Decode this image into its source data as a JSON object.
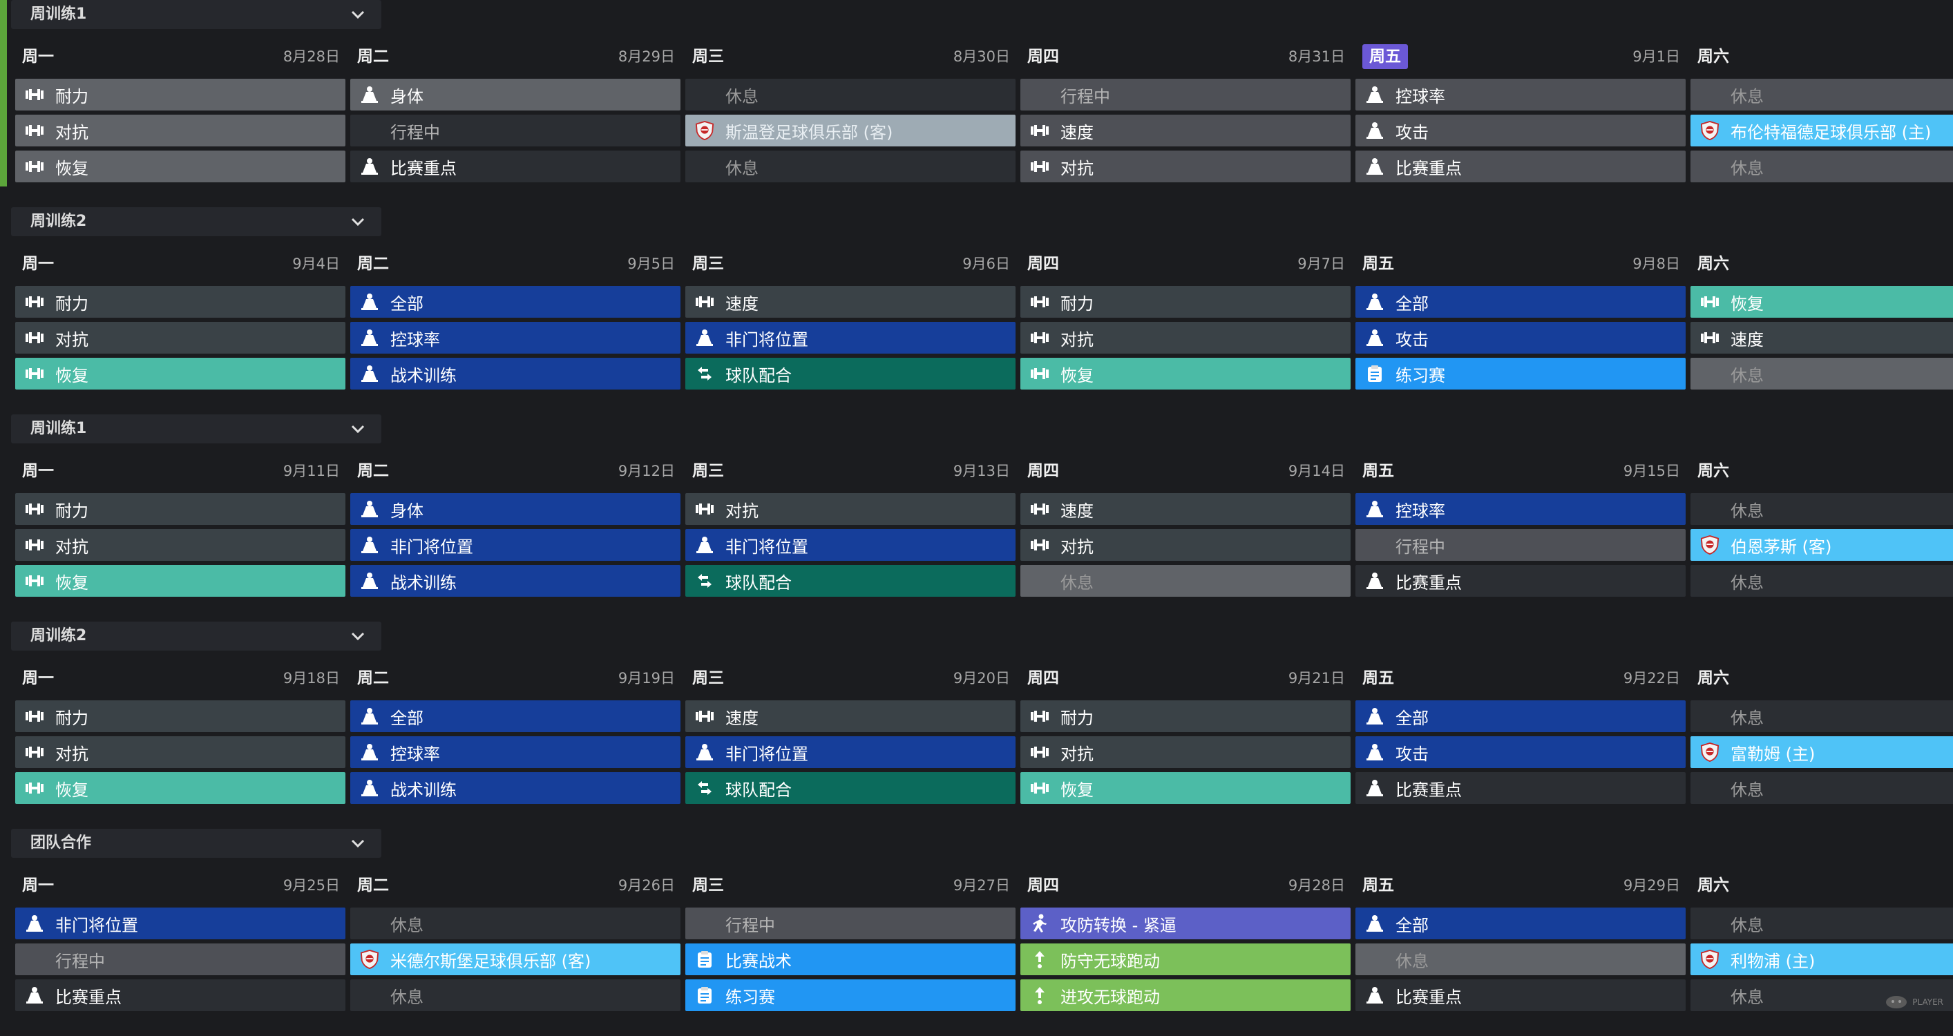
{
  "colors": {
    "grey": "#4e5056",
    "light_grey": "#606368",
    "dark": "#2b2e33",
    "slate": "#3a4247",
    "blue": "#163e9a",
    "teal": "#4bbba6",
    "dark_teal": "#0b6b5c",
    "sky": "#2196f3",
    "cyan": "#4fc3f7",
    "purple": "#5c60c7",
    "green": "#7cc05a",
    "today": "#6b58d6",
    "accent": "#5ca63b"
  },
  "watermark": "PLAYER",
  "weeks": [
    {
      "title": "周训练1",
      "days": [
        {
          "name": "周一",
          "date": "8月28日",
          "cells": [
            {
              "label": "耐力",
              "icon": "dumbbell-icon",
              "tone": "t-lgrey"
            },
            {
              "label": "对抗",
              "icon": "dumbbell-icon",
              "tone": "t-lgrey"
            },
            {
              "label": "恢复",
              "icon": "dumbbell-icon",
              "tone": "t-lgrey"
            }
          ]
        },
        {
          "name": "周二",
          "date": "8月29日",
          "cells": [
            {
              "label": "身体",
              "icon": "cone-icon",
              "tone": "t-lgrey"
            },
            {
              "label": "行程中",
              "icon": "none",
              "tone": "t-dark",
              "kind": "travel"
            },
            {
              "label": "比赛重点",
              "icon": "cone-icon",
              "tone": "t-dark"
            }
          ]
        },
        {
          "name": "周三",
          "date": "8月30日",
          "cells": [
            {
              "label": "休息",
              "icon": "none",
              "tone": "t-dark",
              "kind": "rest"
            },
            {
              "label": "斯温登足球俱乐部 (客)",
              "icon": "club-crest-icon",
              "tone": "t-match-grey"
            },
            {
              "label": "休息",
              "icon": "none",
              "tone": "t-dark",
              "kind": "rest"
            }
          ]
        },
        {
          "name": "周四",
          "date": "8月31日",
          "cells": [
            {
              "label": "行程中",
              "icon": "none",
              "tone": "t-grey",
              "kind": "travel"
            },
            {
              "label": "速度",
              "icon": "dumbbell-icon",
              "tone": "t-grey"
            },
            {
              "label": "对抗",
              "icon": "dumbbell-icon",
              "tone": "t-grey"
            }
          ]
        },
        {
          "name": "周五",
          "date": "9月1日",
          "today": true,
          "cells": [
            {
              "label": "控球率",
              "icon": "cone-icon",
              "tone": "t-grey"
            },
            {
              "label": "攻击",
              "icon": "cone-icon",
              "tone": "t-grey"
            },
            {
              "label": "比赛重点",
              "icon": "cone-icon",
              "tone": "t-grey"
            }
          ]
        },
        {
          "name": "周六",
          "date": "",
          "cells": [
            {
              "label": "休息",
              "icon": "none",
              "tone": "t-grey",
              "kind": "rest"
            },
            {
              "label": "布伦特福德足球俱乐部 (主)",
              "icon": "club-crest-icon",
              "tone": "t-cyan"
            },
            {
              "label": "休息",
              "icon": "none",
              "tone": "t-grey",
              "kind": "rest"
            }
          ]
        }
      ]
    },
    {
      "title": "周训练2",
      "days": [
        {
          "name": "周一",
          "date": "9月4日",
          "cells": [
            {
              "label": "耐力",
              "icon": "dumbbell-icon",
              "tone": "t-slate"
            },
            {
              "label": "对抗",
              "icon": "dumbbell-icon",
              "tone": "t-slate"
            },
            {
              "label": "恢复",
              "icon": "dumbbell-icon",
              "tone": "t-teal"
            }
          ]
        },
        {
          "name": "周二",
          "date": "9月5日",
          "cells": [
            {
              "label": "全部",
              "icon": "cone-icon",
              "tone": "t-blue"
            },
            {
              "label": "控球率",
              "icon": "cone-icon",
              "tone": "t-blue"
            },
            {
              "label": "战术训练",
              "icon": "cone-icon",
              "tone": "t-blue"
            }
          ]
        },
        {
          "name": "周三",
          "date": "9月6日",
          "cells": [
            {
              "label": "速度",
              "icon": "dumbbell-icon",
              "tone": "t-slate"
            },
            {
              "label": "非门将位置",
              "icon": "cone-icon",
              "tone": "t-blue"
            },
            {
              "label": "球队配合",
              "icon": "swap-icon",
              "tone": "t-dteal"
            }
          ]
        },
        {
          "name": "周四",
          "date": "9月7日",
          "cells": [
            {
              "label": "耐力",
              "icon": "dumbbell-icon",
              "tone": "t-slate"
            },
            {
              "label": "对抗",
              "icon": "dumbbell-icon",
              "tone": "t-slate"
            },
            {
              "label": "恢复",
              "icon": "dumbbell-icon",
              "tone": "t-teal"
            }
          ]
        },
        {
          "name": "周五",
          "date": "9月8日",
          "cells": [
            {
              "label": "全部",
              "icon": "cone-icon",
              "tone": "t-blue"
            },
            {
              "label": "攻击",
              "icon": "cone-icon",
              "tone": "t-blue"
            },
            {
              "label": "练习赛",
              "icon": "clipboard-icon",
              "tone": "t-sky"
            }
          ]
        },
        {
          "name": "周六",
          "date": "",
          "cells": [
            {
              "label": "恢复",
              "icon": "dumbbell-icon",
              "tone": "t-teal"
            },
            {
              "label": "速度",
              "icon": "dumbbell-icon",
              "tone": "t-slate"
            },
            {
              "label": "休息",
              "icon": "none",
              "tone": "t-lgrey",
              "kind": "rest"
            }
          ]
        }
      ]
    },
    {
      "title": "周训练1",
      "days": [
        {
          "name": "周一",
          "date": "9月11日",
          "cells": [
            {
              "label": "耐力",
              "icon": "dumbbell-icon",
              "tone": "t-slate"
            },
            {
              "label": "对抗",
              "icon": "dumbbell-icon",
              "tone": "t-slate"
            },
            {
              "label": "恢复",
              "icon": "dumbbell-icon",
              "tone": "t-teal"
            }
          ]
        },
        {
          "name": "周二",
          "date": "9月12日",
          "cells": [
            {
              "label": "身体",
              "icon": "cone-icon",
              "tone": "t-blue"
            },
            {
              "label": "非门将位置",
              "icon": "cone-icon",
              "tone": "t-blue"
            },
            {
              "label": "战术训练",
              "icon": "cone-icon",
              "tone": "t-blue"
            }
          ]
        },
        {
          "name": "周三",
          "date": "9月13日",
          "cells": [
            {
              "label": "对抗",
              "icon": "dumbbell-icon",
              "tone": "t-slate"
            },
            {
              "label": "非门将位置",
              "icon": "cone-icon",
              "tone": "t-blue"
            },
            {
              "label": "球队配合",
              "icon": "swap-icon",
              "tone": "t-dteal"
            }
          ]
        },
        {
          "name": "周四",
          "date": "9月14日",
          "cells": [
            {
              "label": "速度",
              "icon": "dumbbell-icon",
              "tone": "t-slate"
            },
            {
              "label": "对抗",
              "icon": "dumbbell-icon",
              "tone": "t-slate"
            },
            {
              "label": "休息",
              "icon": "none",
              "tone": "t-lgrey",
              "kind": "rest"
            }
          ]
        },
        {
          "name": "周五",
          "date": "9月15日",
          "cells": [
            {
              "label": "控球率",
              "icon": "cone-icon",
              "tone": "t-blue"
            },
            {
              "label": "行程中",
              "icon": "none",
              "tone": "t-grey",
              "kind": "travel"
            },
            {
              "label": "比赛重点",
              "icon": "cone-icon",
              "tone": "t-dark"
            }
          ]
        },
        {
          "name": "周六",
          "date": "",
          "cells": [
            {
              "label": "休息",
              "icon": "none",
              "tone": "t-dark",
              "kind": "rest"
            },
            {
              "label": "伯恩茅斯 (客)",
              "icon": "club-crest-icon",
              "tone": "t-cyan"
            },
            {
              "label": "休息",
              "icon": "none",
              "tone": "t-dark",
              "kind": "rest"
            }
          ]
        }
      ]
    },
    {
      "title": "周训练2",
      "days": [
        {
          "name": "周一",
          "date": "9月18日",
          "cells": [
            {
              "label": "耐力",
              "icon": "dumbbell-icon",
              "tone": "t-slate"
            },
            {
              "label": "对抗",
              "icon": "dumbbell-icon",
              "tone": "t-slate"
            },
            {
              "label": "恢复",
              "icon": "dumbbell-icon",
              "tone": "t-teal"
            }
          ]
        },
        {
          "name": "周二",
          "date": "9月19日",
          "cells": [
            {
              "label": "全部",
              "icon": "cone-icon",
              "tone": "t-blue"
            },
            {
              "label": "控球率",
              "icon": "cone-icon",
              "tone": "t-blue"
            },
            {
              "label": "战术训练",
              "icon": "cone-icon",
              "tone": "t-blue"
            }
          ]
        },
        {
          "name": "周三",
          "date": "9月20日",
          "cells": [
            {
              "label": "速度",
              "icon": "dumbbell-icon",
              "tone": "t-slate"
            },
            {
              "label": "非门将位置",
              "icon": "cone-icon",
              "tone": "t-blue"
            },
            {
              "label": "球队配合",
              "icon": "swap-icon",
              "tone": "t-dteal"
            }
          ]
        },
        {
          "name": "周四",
          "date": "9月21日",
          "cells": [
            {
              "label": "耐力",
              "icon": "dumbbell-icon",
              "tone": "t-slate"
            },
            {
              "label": "对抗",
              "icon": "dumbbell-icon",
              "tone": "t-slate"
            },
            {
              "label": "恢复",
              "icon": "dumbbell-icon",
              "tone": "t-teal"
            }
          ]
        },
        {
          "name": "周五",
          "date": "9月22日",
          "cells": [
            {
              "label": "全部",
              "icon": "cone-icon",
              "tone": "t-blue"
            },
            {
              "label": "攻击",
              "icon": "cone-icon",
              "tone": "t-blue"
            },
            {
              "label": "比赛重点",
              "icon": "cone-icon",
              "tone": "t-dark"
            }
          ]
        },
        {
          "name": "周六",
          "date": "",
          "cells": [
            {
              "label": "休息",
              "icon": "none",
              "tone": "t-dark",
              "kind": "rest"
            },
            {
              "label": "富勒姆 (主)",
              "icon": "club-crest-icon",
              "tone": "t-cyan"
            },
            {
              "label": "休息",
              "icon": "none",
              "tone": "t-dark",
              "kind": "rest"
            }
          ]
        }
      ]
    },
    {
      "title": "团队合作",
      "days": [
        {
          "name": "周一",
          "date": "9月25日",
          "cells": [
            {
              "label": "非门将位置",
              "icon": "cone-icon",
              "tone": "t-blue"
            },
            {
              "label": "行程中",
              "icon": "none",
              "tone": "t-grey",
              "kind": "travel"
            },
            {
              "label": "比赛重点",
              "icon": "cone-icon",
              "tone": "t-dark"
            }
          ]
        },
        {
          "name": "周二",
          "date": "9月26日",
          "cells": [
            {
              "label": "休息",
              "icon": "none",
              "tone": "t-dark",
              "kind": "rest"
            },
            {
              "label": "米德尔斯堡足球俱乐部 (客)",
              "icon": "club-crest-icon",
              "tone": "t-cyan"
            },
            {
              "label": "休息",
              "icon": "none",
              "tone": "t-dark",
              "kind": "rest"
            }
          ]
        },
        {
          "name": "周三",
          "date": "9月27日",
          "cells": [
            {
              "label": "行程中",
              "icon": "none",
              "tone": "t-grey",
              "kind": "travel"
            },
            {
              "label": "比赛战术",
              "icon": "clipboard-icon",
              "tone": "t-sky"
            },
            {
              "label": "练习赛",
              "icon": "clipboard-icon",
              "tone": "t-sky"
            }
          ]
        },
        {
          "name": "周四",
          "date": "9月28日",
          "cells": [
            {
              "label": "攻防转换 - 紧逼",
              "icon": "runner-icon",
              "tone": "t-purple"
            },
            {
              "label": "防守无球跑动",
              "icon": "arrow-run-icon",
              "tone": "t-green"
            },
            {
              "label": "进攻无球跑动",
              "icon": "arrow-run-icon",
              "tone": "t-green"
            }
          ]
        },
        {
          "name": "周五",
          "date": "9月29日",
          "cells": [
            {
              "label": "全部",
              "icon": "cone-icon",
              "tone": "t-blue"
            },
            {
              "label": "休息",
              "icon": "none",
              "tone": "t-lgrey",
              "kind": "rest"
            },
            {
              "label": "比赛重点",
              "icon": "cone-icon",
              "tone": "t-dark"
            }
          ]
        },
        {
          "name": "周六",
          "date": "",
          "cells": [
            {
              "label": "休息",
              "icon": "none",
              "tone": "t-dark",
              "kind": "rest"
            },
            {
              "label": "利物浦 (主)",
              "icon": "club-crest-icon",
              "tone": "t-cyan"
            },
            {
              "label": "休息",
              "icon": "none",
              "tone": "t-dark",
              "kind": "rest"
            }
          ]
        }
      ]
    }
  ]
}
